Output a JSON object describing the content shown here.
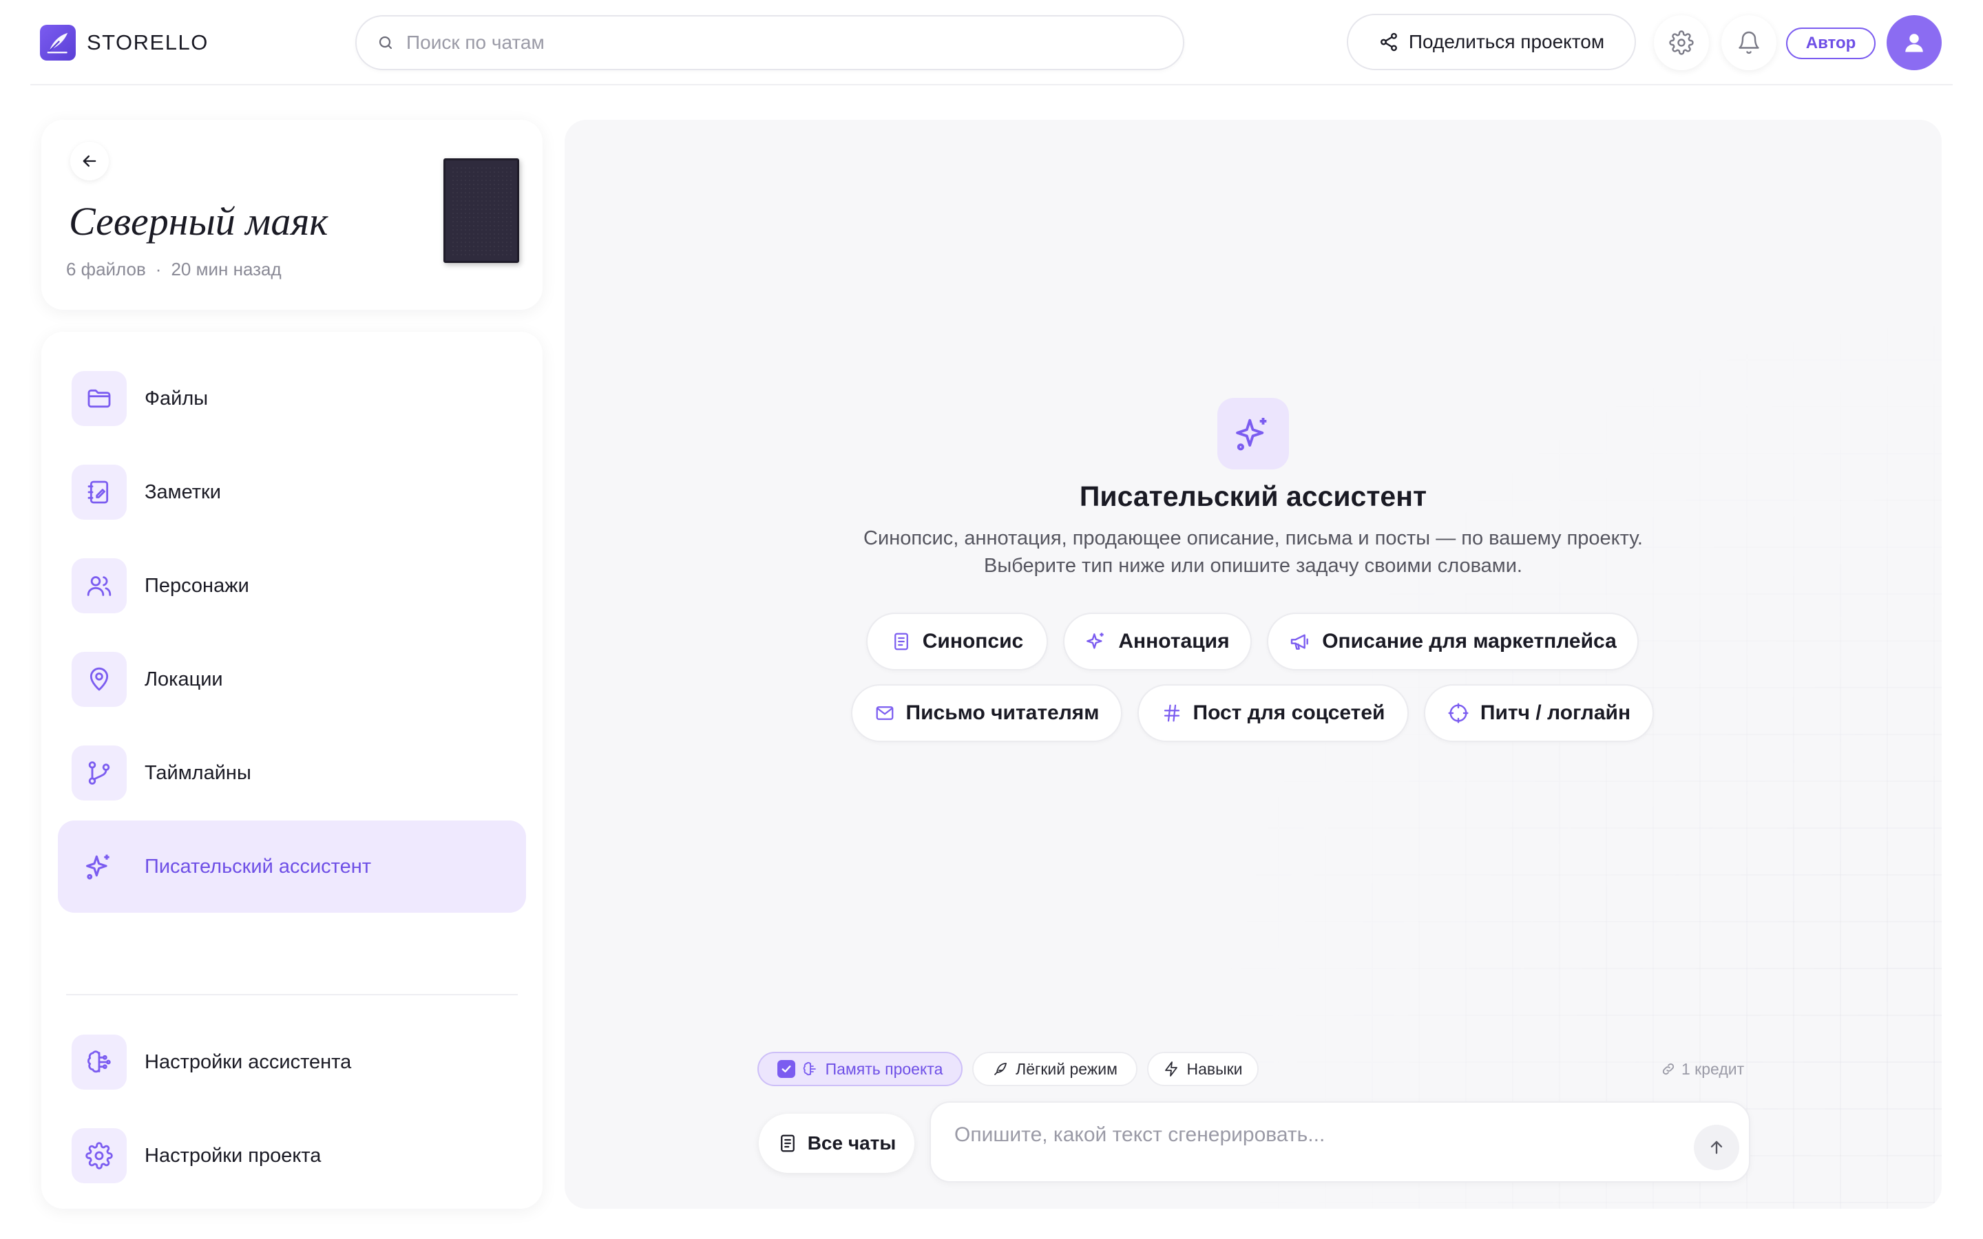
{
  "colors": {
    "accent": "#7b5cf0",
    "accent_text": "#6e4fe6",
    "accent_soft": "#efe9fe",
    "text": "#1a1a24",
    "muted": "#8a8a96",
    "panel_bg": "#f7f7f9"
  },
  "header": {
    "logo_text": "STORELLO",
    "logo_icon": "quill-icon",
    "search": {
      "placeholder": "Поиск по чатам",
      "value": "",
      "icon": "search-icon"
    },
    "share_button": {
      "label": "Поделиться проектом",
      "icon": "share-icon"
    },
    "settings_icon": "gear-icon",
    "notifications_icon": "bell-icon",
    "role_badge": "Автор",
    "avatar_icon": "user-icon"
  },
  "project": {
    "title": "Северный маяк",
    "files_count": "6 файлов",
    "separator": "·",
    "updated": "20 мин назад",
    "back_icon": "arrow-left-icon"
  },
  "sidebar": {
    "items": [
      {
        "label": "Файлы",
        "icon": "folder-icon"
      },
      {
        "label": "Заметки",
        "icon": "notebook-icon"
      },
      {
        "label": "Персонажи",
        "icon": "users-icon"
      },
      {
        "label": "Локации",
        "icon": "map-pin-icon"
      },
      {
        "label": "Таймлайны",
        "icon": "git-branch-icon"
      },
      {
        "label": "Писательский ассистент",
        "icon": "sparkles-icon",
        "active": true
      }
    ],
    "footer_items": [
      {
        "label": "Настройки ассистента",
        "icon": "brain-icon"
      },
      {
        "label": "Настройки проекта",
        "icon": "gear-icon"
      }
    ]
  },
  "assistant": {
    "hero_icon": "sparkles-icon",
    "title": "Писательский ассистент",
    "subtitle_line1": "Синопсис, аннотация, продающее описание, письма и посты — по вашему проекту.",
    "subtitle_line2": "Выберите тип ниже или опишите задачу своими словами.",
    "suggestions": [
      {
        "label": "Синопсис",
        "icon": "document-icon"
      },
      {
        "label": "Аннотация",
        "icon": "sparkles-icon"
      },
      {
        "label": "Описание для маркетплейса",
        "icon": "megaphone-icon"
      },
      {
        "label": "Письмо читателям",
        "icon": "mail-icon"
      },
      {
        "label": "Пост для соцсетей",
        "icon": "hash-icon"
      },
      {
        "label": "Питч / логлайн",
        "icon": "target-icon"
      }
    ]
  },
  "composer": {
    "toggles": [
      {
        "label": "Память проекта",
        "icon": "brain-icon",
        "checked": true
      },
      {
        "label": "Лёгкий режим",
        "icon": "feather-icon"
      },
      {
        "label": "Навыки",
        "icon": "lightning-icon"
      }
    ],
    "credit": "1 кредит",
    "credit_icon": "link-icon",
    "all_chats": "Все чаты",
    "all_chats_icon": "notepad-icon",
    "placeholder": "Опишите, какой текст сгенерировать...",
    "value": "",
    "send_icon": "arrow-up-icon"
  }
}
